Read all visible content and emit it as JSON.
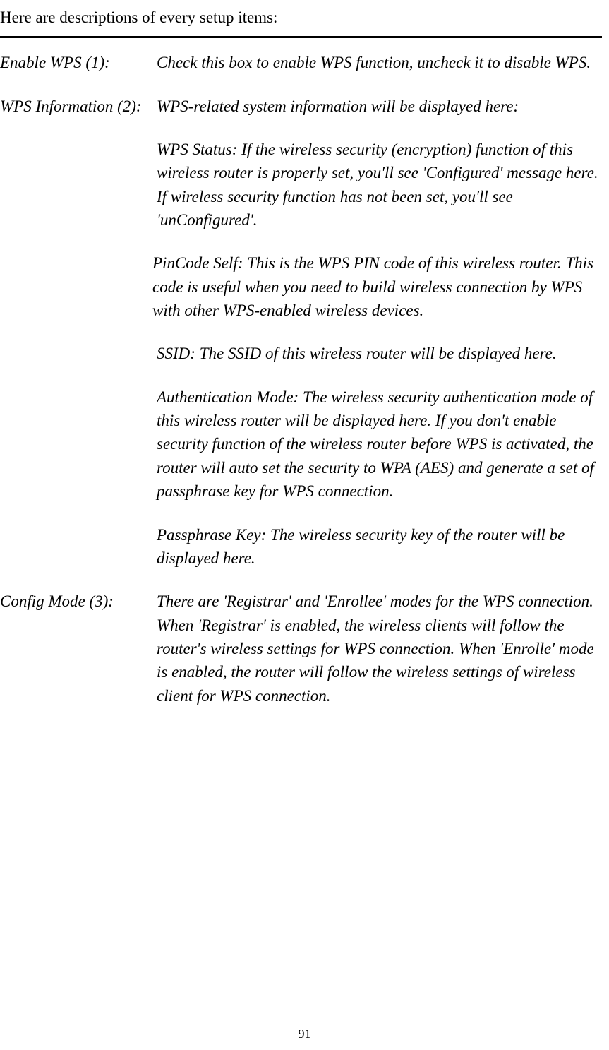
{
  "intro": "Here are descriptions of every setup items:",
  "items": [
    {
      "label": "Enable WPS (1):",
      "descriptions": [
        "Check this box to enable WPS function, uncheck it to disable WPS."
      ]
    },
    {
      "label": "WPS Information (2):",
      "descriptions": [
        "WPS-related system information will be displayed here:",
        "WPS Status: If the wireless security (encryption) function of this wireless router is properly set, you'll see 'Configured' message here. If wireless security function has not been set, you'll see 'unConfigured'.",
        "PinCode Self: This is the WPS PIN code of this wireless router. This code is useful when you need to build wireless connection by WPS with other WPS-enabled wireless devices.",
        "SSID: The SSID of this wireless router will be displayed here.",
        "Authentication Mode: The wireless security authentication mode of this wireless router will be displayed here. If you don't enable security function of the wireless router before WPS is activated, the router will auto set the security to WPA (AES) and generate a set of passphrase key for WPS connection.",
        "Passphrase Key: The wireless security key of the router will be displayed here."
      ]
    },
    {
      "label": "Config Mode (3):",
      "descriptions": [
        "There are 'Registrar' and 'Enrollee' modes for the WPS connection. When 'Registrar' is enabled, the wireless clients will follow the router's wireless settings for WPS connection. When 'Enrolle' mode is enabled, the router will follow the wireless settings of wireless client for WPS connection."
      ]
    }
  ],
  "pageNumber": "91"
}
